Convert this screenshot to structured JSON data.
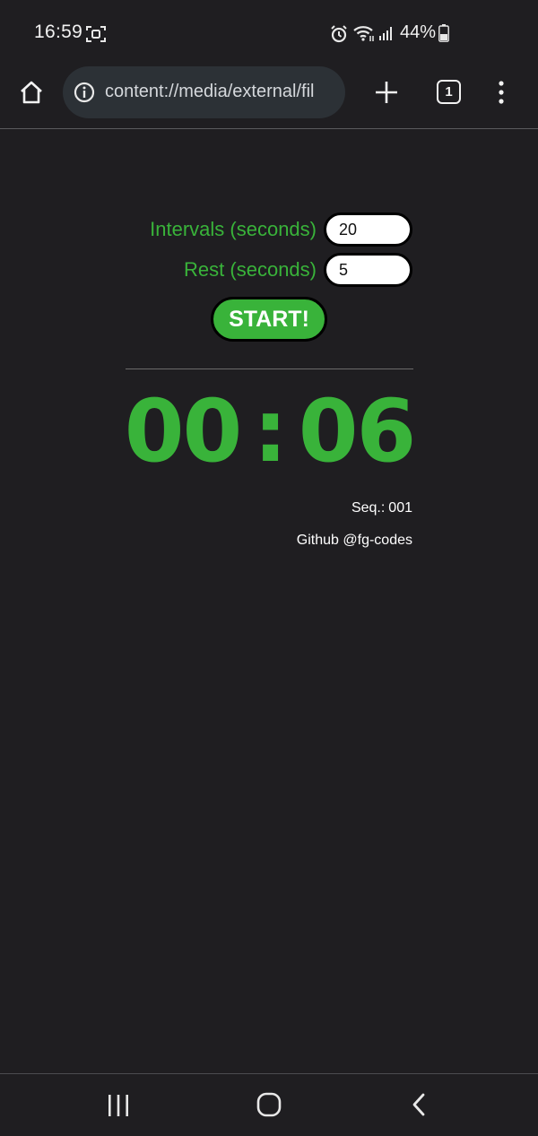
{
  "status_bar": {
    "time": "16:59",
    "battery": "44%",
    "icons": [
      "screenshot-icon",
      "alarm-icon",
      "wifi-icon",
      "signal-icon",
      "battery-icon"
    ]
  },
  "browser": {
    "url": "content://media/external/fil",
    "tab_count": "1",
    "icons": [
      "home-icon",
      "info-icon",
      "plus-icon",
      "tabs-icon",
      "more-vert-icon"
    ]
  },
  "app": {
    "intervals_label": "Intervals (seconds)",
    "intervals_value": "20",
    "rest_label": "Rest (seconds)",
    "rest_value": "5",
    "start_label": "START!",
    "timer": {
      "minutes": "00",
      "separator": ":",
      "seconds": "06"
    },
    "seq_label": "Seq.:",
    "seq_value": "001",
    "github": "Github @fg-codes"
  },
  "nav_bar": {
    "icons": [
      "recents-icon",
      "home-circle-icon",
      "back-icon"
    ]
  },
  "colors": {
    "background": "#1f1e21",
    "accent_green": "#39b33a",
    "input_bg": "#ffffff",
    "text": "#ffffff"
  }
}
